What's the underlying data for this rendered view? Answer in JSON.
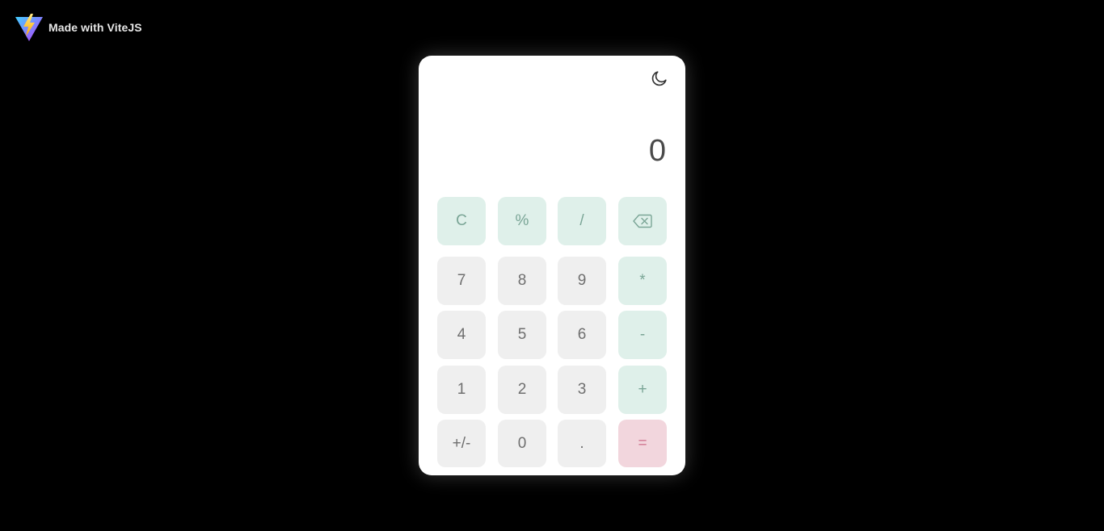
{
  "brand": {
    "text": "Made with ViteJS",
    "logo_icon": "vite-logo-icon"
  },
  "colors": {
    "background": "#000000",
    "card": "#ffffff",
    "number_key": "#efefef",
    "operator_key": "#dff0ea",
    "operator_text": "#7aa596",
    "equals_key": "#f2d6dd",
    "equals_text": "#d07891"
  },
  "calculator": {
    "theme_icon": "moon-icon",
    "display_value": "0",
    "keys": {
      "clear": "C",
      "percent": "%",
      "divide": "/",
      "backspace_icon": "backspace-icon",
      "seven": "7",
      "eight": "8",
      "nine": "9",
      "multiply": "*",
      "four": "4",
      "five": "5",
      "six": "6",
      "subtract": "-",
      "one": "1",
      "two": "2",
      "three": "3",
      "add": "+",
      "negate": "+/-",
      "zero": "0",
      "decimal": ".",
      "equals": "="
    }
  }
}
